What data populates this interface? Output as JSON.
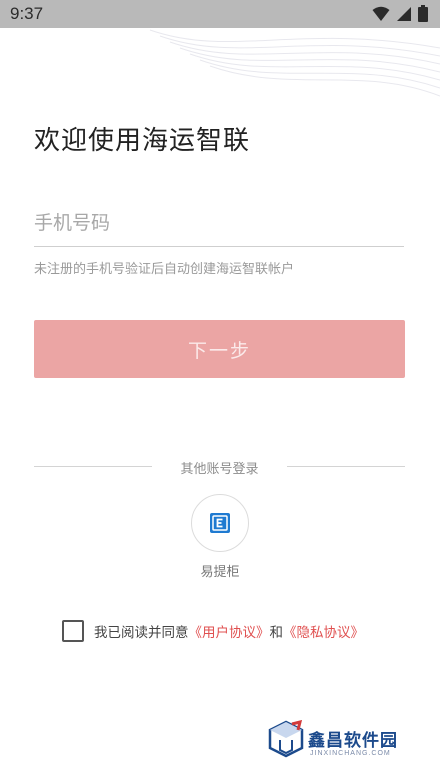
{
  "status_bar": {
    "time": "9:37",
    "icons": [
      "wifi-icon",
      "cellular-signal-icon",
      "battery-icon"
    ]
  },
  "login": {
    "title": "欢迎使用海运智联",
    "phone_placeholder": "手机号码",
    "hint": "未注册的手机号验证后自动创建海运智联帐户",
    "next_button": "下一步"
  },
  "other_login": {
    "divider_text": "其他账号登录",
    "options": [
      {
        "label": "易提柜",
        "icon": "e-locker-icon"
      }
    ]
  },
  "agreement": {
    "checked": false,
    "prefix": "我已阅读并同意",
    "user_agreement": "《用户协议》",
    "conjunction": "和",
    "privacy_policy": "《隐私协议》"
  },
  "watermark": {
    "name": "鑫昌软件园",
    "domain": "JINXINCHANG.COM"
  },
  "colors": {
    "accent": "#e05050",
    "button_disabled": "#eba5a4",
    "icon_blue": "#1f7ad1"
  }
}
